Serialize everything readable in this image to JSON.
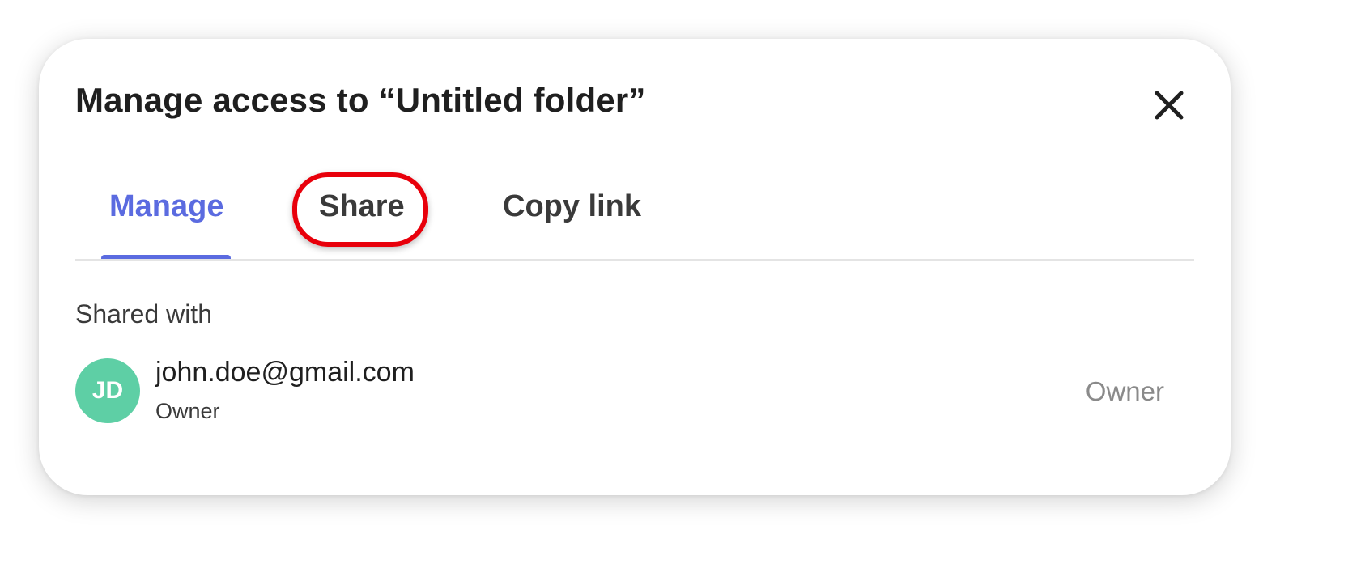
{
  "dialog": {
    "title": "Manage access to “Untitled folder”",
    "close_icon": "close-icon"
  },
  "tabs": [
    {
      "label": "Manage",
      "active": true
    },
    {
      "label": "Share",
      "active": false,
      "highlighted": true
    },
    {
      "label": "Copy link",
      "active": false
    }
  ],
  "shared_with": {
    "label": "Shared with",
    "users": [
      {
        "initials": "JD",
        "email": "john.doe@gmail.com",
        "role_subtitle": "Owner",
        "role": "Owner"
      }
    ]
  },
  "colors": {
    "accent": "#5b6be0",
    "highlight": "#e8000b",
    "avatar": "#5ecfa5"
  }
}
